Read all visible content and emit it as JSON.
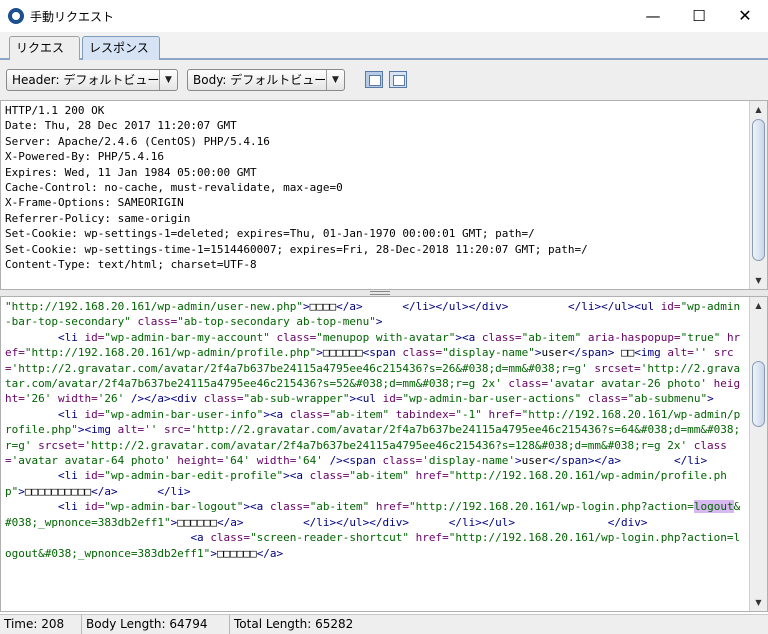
{
  "window": {
    "title": "手動リクエスト",
    "controls": {
      "minimize": "—",
      "maximize": "☐",
      "close": "✕"
    }
  },
  "tabs": [
    {
      "label": "リクエスト"
    },
    {
      "label": "レスポンス"
    }
  ],
  "toolbar": {
    "header_view": "Header: デフォルトビュー",
    "body_view": "Body: デフォルトビュー"
  },
  "response_header_lines": [
    "HTTP/1.1 200 OK",
    "Date: Thu, 28 Dec 2017 11:20:07 GMT",
    "Server: Apache/2.4.6 (CentOS) PHP/5.4.16",
    "X-Powered-By: PHP/5.4.16",
    "Expires: Wed, 11 Jan 1984 05:00:00 GMT",
    "Cache-Control: no-cache, must-revalidate, max-age=0",
    "X-Frame-Options: SAMEORIGIN",
    "Referrer-Policy: same-origin",
    "Set-Cookie: wp-settings-1=deleted; expires=Thu, 01-Jan-1970 00:00:01 GMT; path=/",
    "Set-Cookie: wp-settings-time-1=1514460007; expires=Fri, 28-Dec-2018 11:20:07 GMT; path=/",
    "Content-Type: text/html; charset=UTF-8"
  ],
  "response_body": [
    [
      [
        "val",
        "\"http://192.168.20.161/wp-admin/user-new.php\""
      ],
      [
        "tag",
        ">"
      ],
      [
        "txt",
        "□□□□"
      ],
      [
        "tag",
        "</a>"
      ],
      [
        "txt",
        "      "
      ],
      [
        "tag",
        "</li></ul></div>"
      ],
      [
        "txt",
        "         "
      ],
      [
        "tag",
        "</li></ul><ul "
      ],
      [
        "attr",
        "id="
      ],
      [
        "val",
        "\"wp-admin-bar-top-secondary\" "
      ],
      [
        "attr",
        "class="
      ],
      [
        "val",
        "\"ab-top-secondary ab-top-menu\""
      ],
      [
        "tag",
        ">"
      ]
    ],
    [
      [
        "txt",
        "        "
      ],
      [
        "tag",
        "<li "
      ],
      [
        "attr",
        "id="
      ],
      [
        "val",
        "\"wp-admin-bar-my-account\" "
      ],
      [
        "attr",
        "class="
      ],
      [
        "val",
        "\"menupop with-avatar\""
      ],
      [
        "tag",
        "><a "
      ],
      [
        "attr",
        "class="
      ],
      [
        "val",
        "\"ab-item\" "
      ],
      [
        "attr",
        "aria-haspopup="
      ],
      [
        "val",
        "\"true\" "
      ],
      [
        "attr",
        "href="
      ],
      [
        "val",
        "\"http://192.168.20.161/wp-admin/profile.php\""
      ],
      [
        "tag",
        ">"
      ],
      [
        "txt",
        "□□□□□□"
      ],
      [
        "tag",
        "<span "
      ],
      [
        "attr",
        "class="
      ],
      [
        "val",
        "\"display-name\""
      ],
      [
        "tag",
        ">"
      ],
      [
        "txt",
        "user"
      ],
      [
        "tag",
        "</span>"
      ],
      [
        "txt",
        " □□"
      ],
      [
        "tag",
        "<img "
      ],
      [
        "attr",
        "alt="
      ],
      [
        "val",
        "'' "
      ],
      [
        "attr",
        "src="
      ],
      [
        "val",
        "'http://2.gravatar.com/avatar/2f4a7b637be24115a4795ee46c215436?s=26&#038;d=mm&#038;r=g' "
      ],
      [
        "attr",
        "srcset="
      ],
      [
        "val",
        "'http://2.gravatar.com/avatar/2f4a7b637be24115a4795ee46c215436?s=52&#038;d=mm&#038;r=g 2x' "
      ],
      [
        "attr",
        "class="
      ],
      [
        "val",
        "'avatar avatar-26 photo' "
      ],
      [
        "attr",
        "height="
      ],
      [
        "val",
        "'26' "
      ],
      [
        "attr",
        "width="
      ],
      [
        "val",
        "'26' "
      ],
      [
        "tag",
        "/></a><div "
      ],
      [
        "attr",
        "class="
      ],
      [
        "val",
        "\"ab-sub-wrapper\""
      ],
      [
        "tag",
        "><ul "
      ],
      [
        "attr",
        "id="
      ],
      [
        "val",
        "\"wp-admin-bar-user-actions\" "
      ],
      [
        "attr",
        "class="
      ],
      [
        "val",
        "\"ab-submenu\""
      ],
      [
        "tag",
        ">"
      ]
    ],
    [
      [
        "txt",
        "        "
      ],
      [
        "tag",
        "<li "
      ],
      [
        "attr",
        "id="
      ],
      [
        "val",
        "\"wp-admin-bar-user-info\""
      ],
      [
        "tag",
        "><a "
      ],
      [
        "attr",
        "class="
      ],
      [
        "val",
        "\"ab-item\" "
      ],
      [
        "attr",
        "tabindex="
      ],
      [
        "val",
        "\"-1\" "
      ],
      [
        "attr",
        "href="
      ],
      [
        "val",
        "\"http://192.168.20.161/wp-admin/profile.php\""
      ],
      [
        "tag",
        "><img "
      ],
      [
        "attr",
        "alt="
      ],
      [
        "val",
        "'' "
      ],
      [
        "attr",
        "src="
      ],
      [
        "val",
        "'http://2.gravatar.com/avatar/2f4a7b637be24115a4795ee46c215436?s=64&#038;d=mm&#038;r=g' "
      ],
      [
        "attr",
        "srcset="
      ],
      [
        "val",
        "'http://2.gravatar.com/avatar/2f4a7b637be24115a4795ee46c215436?s=128&#038;d=mm&#038;r=g 2x' "
      ],
      [
        "attr",
        "class="
      ],
      [
        "val",
        "'avatar avatar-64 photo' "
      ],
      [
        "attr",
        "height="
      ],
      [
        "val",
        "'64' "
      ],
      [
        "attr",
        "width="
      ],
      [
        "val",
        "'64' "
      ],
      [
        "tag",
        "/><span "
      ],
      [
        "attr",
        "class="
      ],
      [
        "val",
        "'display-name'"
      ],
      [
        "tag",
        ">"
      ],
      [
        "txt",
        "user"
      ],
      [
        "tag",
        "</span></a>"
      ],
      [
        "txt",
        "        "
      ],
      [
        "tag",
        "</li>"
      ]
    ],
    [
      [
        "txt",
        "        "
      ],
      [
        "tag",
        "<li "
      ],
      [
        "attr",
        "id="
      ],
      [
        "val",
        "\"wp-admin-bar-edit-profile\""
      ],
      [
        "tag",
        "><a "
      ],
      [
        "attr",
        "class="
      ],
      [
        "val",
        "\"ab-item\" "
      ],
      [
        "attr",
        "href="
      ],
      [
        "val",
        "\"http://192.168.20.161/wp-admin/profile.php\""
      ],
      [
        "tag",
        ">"
      ],
      [
        "txt",
        "□□□□□□□□□□"
      ],
      [
        "tag",
        "</a>"
      ],
      [
        "txt",
        "      "
      ],
      [
        "tag",
        "</li>"
      ]
    ],
    [
      [
        "txt",
        "        "
      ],
      [
        "tag",
        "<li "
      ],
      [
        "attr",
        "id="
      ],
      [
        "val",
        "\"wp-admin-bar-logout\""
      ],
      [
        "tag",
        "><a "
      ],
      [
        "attr",
        "class="
      ],
      [
        "val",
        "\"ab-item\" "
      ],
      [
        "attr",
        "href="
      ],
      [
        "val",
        "\"http://192.168.20.161/wp-login.php?action="
      ],
      [
        "hl",
        "logout"
      ],
      [
        "val",
        "&#038;_wpnonce=383db2eff1\""
      ],
      [
        "tag",
        ">"
      ],
      [
        "txt",
        "□□□□□□"
      ],
      [
        "tag",
        "</a>"
      ],
      [
        "txt",
        "         "
      ],
      [
        "tag",
        "</li></ul></div>"
      ],
      [
        "txt",
        "      "
      ],
      [
        "tag",
        "</li></ul>"
      ],
      [
        "txt",
        "              "
      ],
      [
        "tag",
        "</div>"
      ]
    ],
    [
      [
        "txt",
        "                            "
      ],
      [
        "tag",
        "<a "
      ],
      [
        "attr",
        "class="
      ],
      [
        "val",
        "\"screen-reader-shortcut\" "
      ],
      [
        "attr",
        "href="
      ],
      [
        "val",
        "\"http://192.168.20.161/wp-login.php?action=logout&#038;_wpnonce=383db2eff1\""
      ],
      [
        "tag",
        ">"
      ],
      [
        "txt",
        "□□□□□□"
      ],
      [
        "tag",
        "</a>"
      ]
    ]
  ],
  "status": {
    "time": "Time: 208 ms",
    "body_length": "Body Length: 64794 bytes",
    "total_length": "Total Length: 65282 bytes"
  }
}
